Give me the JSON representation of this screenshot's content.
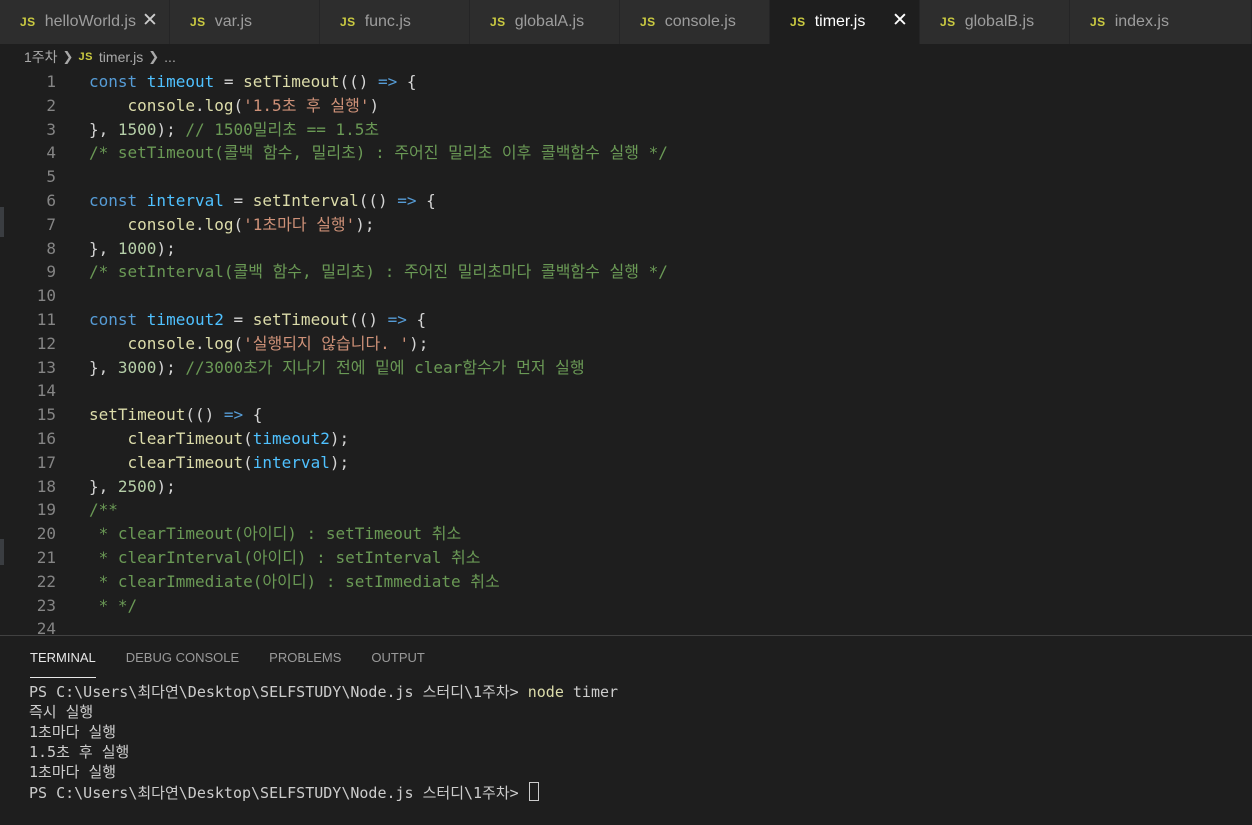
{
  "tabs": [
    {
      "badge": "JS",
      "label": "helloWorld.js",
      "close": "✕"
    },
    {
      "badge": "JS",
      "label": "var.js"
    },
    {
      "badge": "JS",
      "label": "func.js"
    },
    {
      "badge": "JS",
      "label": "globalA.js"
    },
    {
      "badge": "JS",
      "label": "console.js"
    },
    {
      "badge": "JS",
      "label": "timer.js",
      "close": "✕"
    },
    {
      "badge": "JS",
      "label": "globalB.js"
    },
    {
      "badge": "JS",
      "label": "index.js"
    }
  ],
  "breadcrumb": {
    "folder": "1주차",
    "badge": "JS",
    "file": "timer.js",
    "tail": "..."
  },
  "editor": {
    "lines": [
      {
        "n": "1",
        "tokens": [
          [
            "kw",
            "const "
          ],
          [
            "var",
            "timeout"
          ],
          [
            "pun",
            " = "
          ],
          [
            "fn",
            "setTimeout"
          ],
          [
            "pun",
            "(() "
          ],
          [
            "kw",
            "=>"
          ],
          [
            "pun",
            " {"
          ]
        ]
      },
      {
        "n": "2",
        "tokens": [
          [
            "pun",
            "    "
          ],
          [
            "fn",
            "console"
          ],
          [
            "pun",
            "."
          ],
          [
            "fn",
            "log"
          ],
          [
            "pun",
            "("
          ],
          [
            "str",
            "'1.5초 후 실행'"
          ],
          [
            "pun",
            ")"
          ]
        ]
      },
      {
        "n": "3",
        "tokens": [
          [
            "pun",
            "}, "
          ],
          [
            "num",
            "1500"
          ],
          [
            "pun",
            "); "
          ],
          [
            "com",
            "// 1500밀리초 == 1.5초"
          ]
        ]
      },
      {
        "n": "4",
        "tokens": [
          [
            "com",
            "/* setTimeout(콜백 함수, 밀리초) : 주어진 밀리초 이후 콜백함수 실행 */"
          ]
        ]
      },
      {
        "n": "5",
        "tokens": []
      },
      {
        "n": "6",
        "tokens": [
          [
            "kw",
            "const "
          ],
          [
            "var",
            "interval"
          ],
          [
            "pun",
            " = "
          ],
          [
            "fn",
            "setInterval"
          ],
          [
            "pun",
            "(() "
          ],
          [
            "kw",
            "=>"
          ],
          [
            "pun",
            " {"
          ]
        ]
      },
      {
        "n": "7",
        "tokens": [
          [
            "pun",
            "    "
          ],
          [
            "fn",
            "console"
          ],
          [
            "pun",
            "."
          ],
          [
            "fn",
            "log"
          ],
          [
            "pun",
            "("
          ],
          [
            "str",
            "'1초마다 실행'"
          ],
          [
            "pun",
            ");"
          ]
        ]
      },
      {
        "n": "8",
        "tokens": [
          [
            "pun",
            "}, "
          ],
          [
            "num",
            "1000"
          ],
          [
            "pun",
            ");"
          ]
        ]
      },
      {
        "n": "9",
        "tokens": [
          [
            "com",
            "/* setInterval(콜백 함수, 밀리초) : 주어진 밀리초마다 콜백함수 실행 */"
          ]
        ]
      },
      {
        "n": "10",
        "tokens": []
      },
      {
        "n": "11",
        "tokens": [
          [
            "kw",
            "const "
          ],
          [
            "var",
            "timeout2"
          ],
          [
            "pun",
            " = "
          ],
          [
            "fn",
            "setTimeout"
          ],
          [
            "pun",
            "(() "
          ],
          [
            "kw",
            "=>"
          ],
          [
            "pun",
            " {"
          ]
        ]
      },
      {
        "n": "12",
        "tokens": [
          [
            "pun",
            "    "
          ],
          [
            "fn",
            "console"
          ],
          [
            "pun",
            "."
          ],
          [
            "fn",
            "log"
          ],
          [
            "pun",
            "("
          ],
          [
            "str",
            "'실행되지 않습니다. '"
          ],
          [
            "pun",
            ");"
          ]
        ]
      },
      {
        "n": "13",
        "tokens": [
          [
            "pun",
            "}, "
          ],
          [
            "num",
            "3000"
          ],
          [
            "pun",
            "); "
          ],
          [
            "com",
            "//3000초가 지나기 전에 밑에 clear함수가 먼저 실행"
          ]
        ]
      },
      {
        "n": "14",
        "tokens": []
      },
      {
        "n": "15",
        "tokens": [
          [
            "fn",
            "setTimeout"
          ],
          [
            "pun",
            "(() "
          ],
          [
            "kw",
            "=>"
          ],
          [
            "pun",
            " {"
          ]
        ]
      },
      {
        "n": "16",
        "tokens": [
          [
            "pun",
            "    "
          ],
          [
            "fn",
            "clearTimeout"
          ],
          [
            "pun",
            "("
          ],
          [
            "var",
            "timeout2"
          ],
          [
            "pun",
            ");"
          ]
        ]
      },
      {
        "n": "17",
        "tokens": [
          [
            "pun",
            "    "
          ],
          [
            "fn",
            "clearTimeout"
          ],
          [
            "pun",
            "("
          ],
          [
            "var",
            "interval"
          ],
          [
            "pun",
            ");"
          ]
        ]
      },
      {
        "n": "18",
        "tokens": [
          [
            "pun",
            "}, "
          ],
          [
            "num",
            "2500"
          ],
          [
            "pun",
            ");"
          ]
        ]
      },
      {
        "n": "19",
        "tokens": [
          [
            "com",
            "/**"
          ]
        ]
      },
      {
        "n": "20",
        "tokens": [
          [
            "com",
            " * clearTimeout(아이디) : setTimeout 취소"
          ]
        ]
      },
      {
        "n": "21",
        "tokens": [
          [
            "com",
            " * clearInterval(아이디) : setInterval 취소"
          ]
        ]
      },
      {
        "n": "22",
        "tokens": [
          [
            "com",
            " * clearImmediate(아이디) : setImmediate 취소"
          ]
        ]
      },
      {
        "n": "23",
        "tokens": [
          [
            "com",
            " * */"
          ]
        ]
      },
      {
        "n": "24",
        "tokens": []
      }
    ]
  },
  "panel": {
    "tabs": [
      "TERMINAL",
      "DEBUG CONSOLE",
      "PROBLEMS",
      "OUTPUT"
    ],
    "active_tab": "TERMINAL"
  },
  "terminal": {
    "prompt": "PS C:\\Users\\최다연\\Desktop\\SELFSTUDY\\Node.js 스터디\\1주차> ",
    "command": "node",
    "command_arg": " timer",
    "output": [
      "즉시 실행",
      "1초마다 실행",
      "1.5초 후 실행",
      "1초마다 실행"
    ],
    "final_prompt": "PS C:\\Users\\최다연\\Desktop\\SELFSTUDY\\Node.js 스터디\\1주차> "
  },
  "colors": {
    "keyword": "#569cd6",
    "variable": "#4fc1ff",
    "function": "#dcdcaa",
    "string": "#ce9178",
    "number": "#b5cea8",
    "comment": "#6a9955",
    "js_badge": "#cbcb41"
  }
}
